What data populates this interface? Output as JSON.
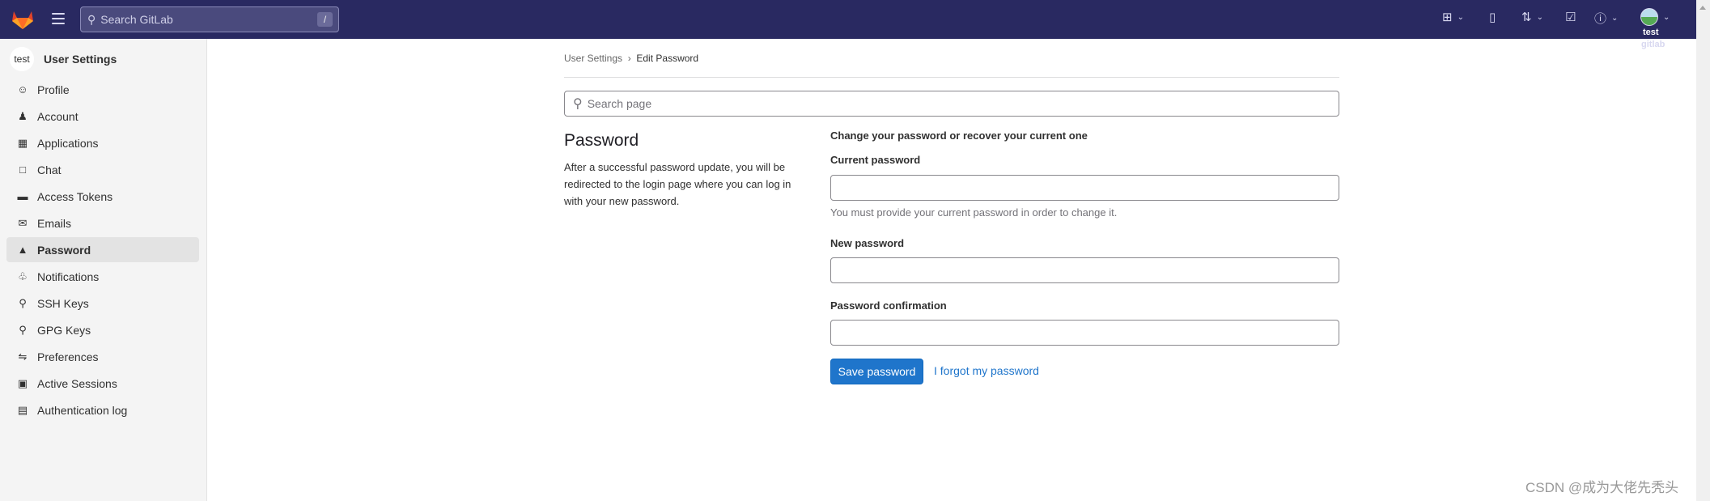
{
  "topbar": {
    "search_placeholder": "Search GitLab",
    "shortcut": "/",
    "avatar_user": "test",
    "avatar_sub": "gitlab"
  },
  "sidebar": {
    "title": "User Settings",
    "avatar_text": "test",
    "items": [
      {
        "label": "Profile",
        "icon": "profile-icon"
      },
      {
        "label": "Account",
        "icon": "account-icon"
      },
      {
        "label": "Applications",
        "icon": "applications-icon"
      },
      {
        "label": "Chat",
        "icon": "chat-icon"
      },
      {
        "label": "Access Tokens",
        "icon": "token-icon"
      },
      {
        "label": "Emails",
        "icon": "email-icon"
      },
      {
        "label": "Password",
        "icon": "lock-icon",
        "active": true
      },
      {
        "label": "Notifications",
        "icon": "bell-icon"
      },
      {
        "label": "SSH Keys",
        "icon": "key-icon"
      },
      {
        "label": "GPG Keys",
        "icon": "key-icon"
      },
      {
        "label": "Preferences",
        "icon": "preferences-icon"
      },
      {
        "label": "Active Sessions",
        "icon": "monitor-icon"
      },
      {
        "label": "Authentication log",
        "icon": "log-icon"
      }
    ]
  },
  "breadcrumb": {
    "parent": "User Settings",
    "current": "Edit Password"
  },
  "search": {
    "placeholder": "Search page"
  },
  "section": {
    "title": "Password",
    "description": "After a successful password update, you will be redirected to the login page where you can log in with your new password."
  },
  "form": {
    "heading": "Change your password or recover your current one",
    "current_label": "Current password",
    "current_help": "You must provide your current password in order to change it.",
    "new_label": "New password",
    "confirm_label": "Password confirmation",
    "save_label": "Save password",
    "forgot_label": "I forgot my password"
  },
  "watermark": "CSDN @成为大佬先秃头",
  "colors": {
    "topbar": "#292961",
    "primary": "#1f75cb"
  }
}
